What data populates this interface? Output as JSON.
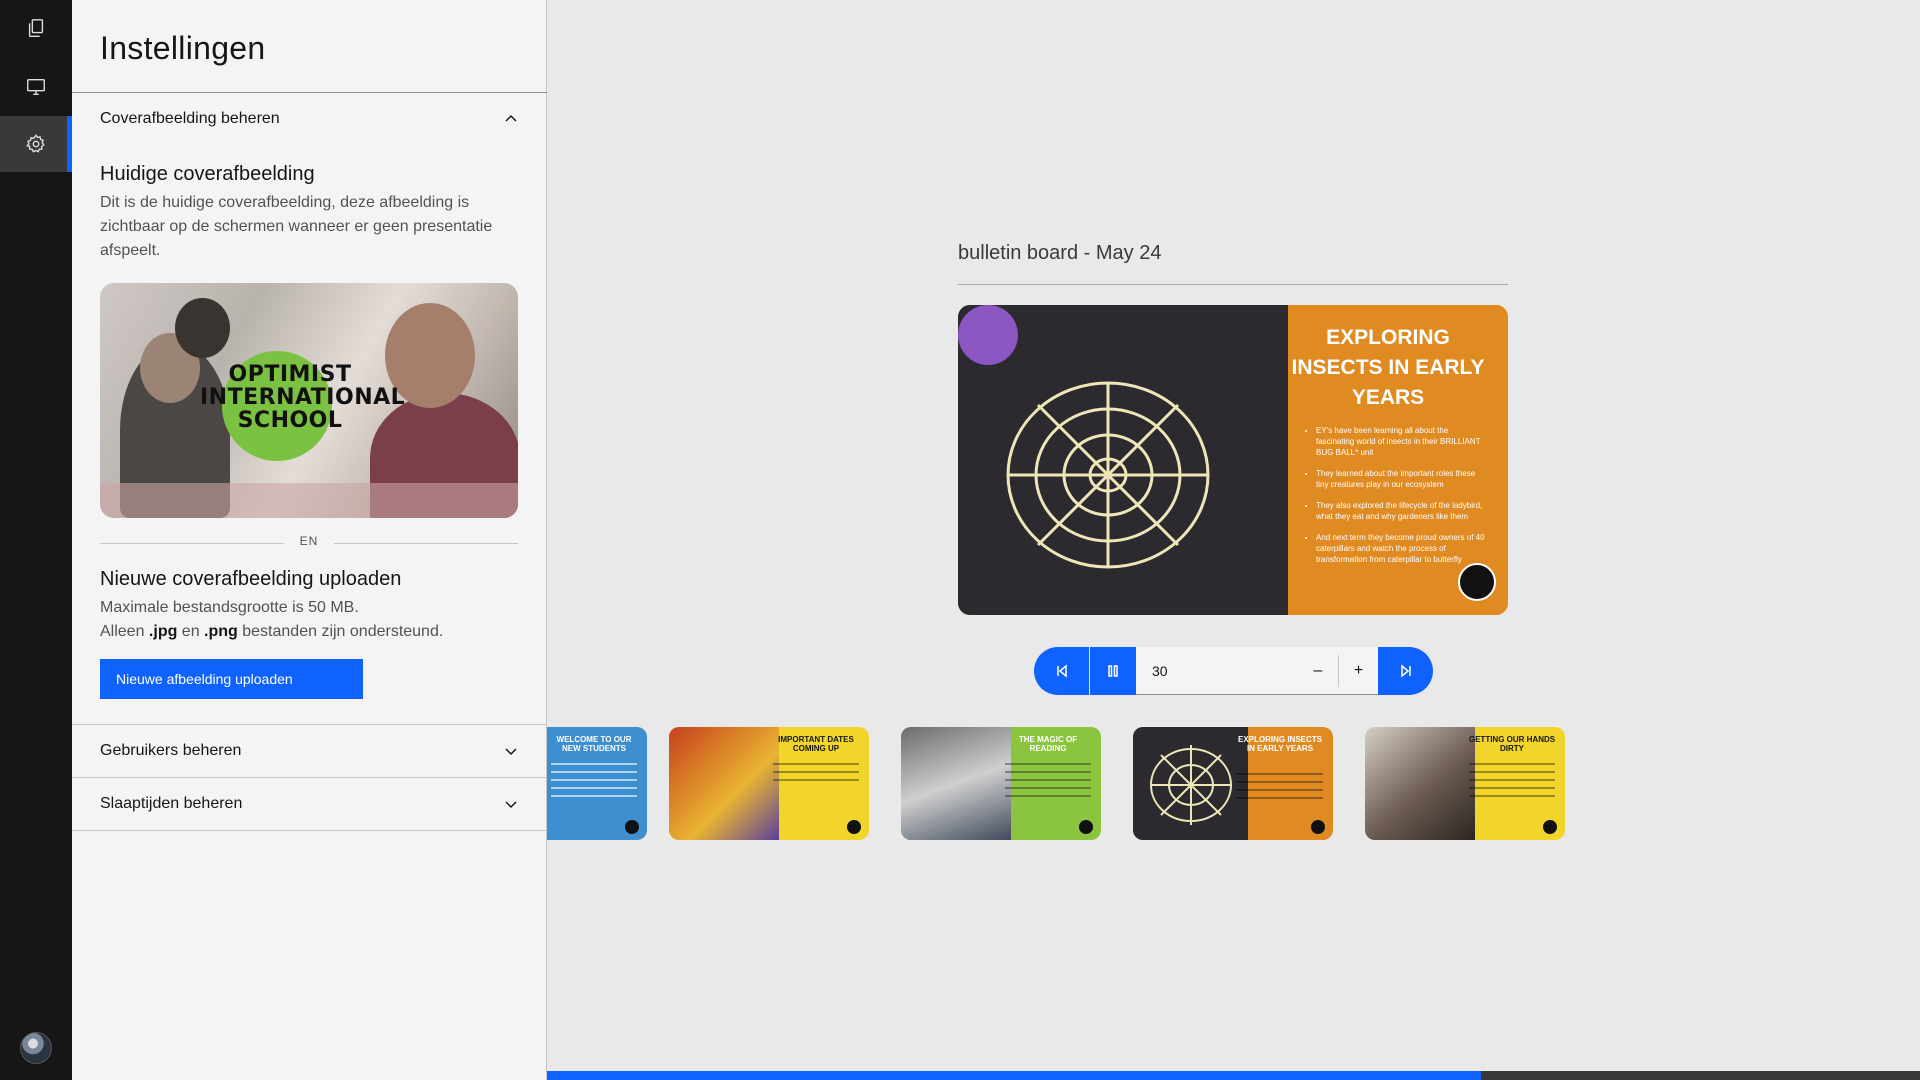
{
  "rail": {
    "items": [
      {
        "icon": "copy-icon"
      },
      {
        "icon": "monitor-icon"
      },
      {
        "icon": "gear-icon",
        "active": true
      }
    ],
    "avatar": "avatar"
  },
  "panel": {
    "title": "Instellingen",
    "sections": {
      "cover": {
        "header": "Coverafbeelding beheren",
        "expanded": true,
        "current_title": "Huidige coverafbeelding",
        "current_desc": "Dit is de huidige coverafbeelding, deze afbeelding is zichtbaar op de schermen wanneer er geen presentatie afspeelt.",
        "cover_logo_text": "OPTIMIST INTERNATIONAL SCHOOL",
        "divider_label": "EN",
        "upload_title": "Nieuwe coverafbeelding uploaden",
        "upload_size_note": "Maximale bestandsgrootte is 50 MB.",
        "upload_types_prefix": "Alleen ",
        "upload_type_jpg": ".jpg",
        "upload_types_mid": " en ",
        "upload_type_png": ".png",
        "upload_types_suffix": " bestanden zijn ondersteund.",
        "upload_button": "Nieuwe afbeelding uploaden"
      },
      "users": {
        "header": "Gebruikers beheren"
      },
      "sleep": {
        "header": "Slaaptijden beheren"
      }
    }
  },
  "main": {
    "presentation_title": "bulletin board - May 24",
    "current_slide": {
      "title": "EXPLORING INSECTS IN EARLY YEARS",
      "bullets": [
        "EY's have been learning all about the fascinating world of insects in their BRILLIANT BUG BALL* unit",
        "They learned about the important roles these tiny creatures play in our ecosystem",
        "They also explored the lifecycle of the ladybird, what they eat and why gardeners like them",
        "And next term they become proud owners of 40 caterpillars and watch the process of transformation from caterpillar to butterfly"
      ]
    },
    "controls": {
      "interval_value": "30",
      "minus": "–",
      "plus": "+"
    },
    "thumbnails": [
      {
        "title": "WELCOME TO OUR NEW STUDENTS"
      },
      {
        "title": "IMPORTANT DATES COMING UP"
      },
      {
        "title": "THE MAGIC OF READING"
      },
      {
        "title": "EXPLORING INSECTS IN EARLY YEARS"
      },
      {
        "title": "GETTING OUR HANDS DIRTY"
      }
    ],
    "progress": 0.68,
    "colors": {
      "accent": "#0f62fe",
      "rail": "#161616",
      "slide_orange": "#e08a22",
      "thumb_yellow": "#f2d52a"
    }
  }
}
